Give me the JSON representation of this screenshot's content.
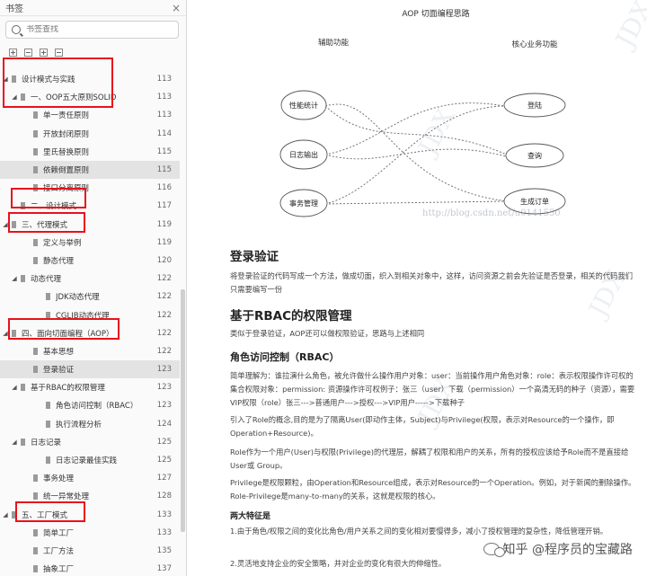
{
  "sidebar": {
    "title": "书签",
    "close_glyph": "×",
    "search": {
      "placeholder": "书签查找",
      "icon": "search-icon"
    },
    "items": [
      {
        "label": "设计模式与实践",
        "page": "113",
        "level": 0,
        "arrow": "◢"
      },
      {
        "label": "一、OOP五大原则SOLID",
        "page": "113",
        "level": 1,
        "arrow": "◢"
      },
      {
        "label": "单一责任原则",
        "page": "113",
        "level": 2,
        "arrow": ""
      },
      {
        "label": "开放封闭原则",
        "page": "114",
        "level": 2,
        "arrow": ""
      },
      {
        "label": "里氏替换原则",
        "page": "115",
        "level": 2,
        "arrow": ""
      },
      {
        "label": "依赖倒置原则",
        "page": "115",
        "level": 2,
        "arrow": "",
        "selected": true
      },
      {
        "label": "接口分离原则",
        "page": "116",
        "level": 2,
        "arrow": ""
      },
      {
        "label": "二、设计模式",
        "page": "117",
        "level": 1,
        "arrow": ""
      },
      {
        "label": "三、代理模式",
        "page": "119",
        "level": 0,
        "arrow": "◢"
      },
      {
        "label": "定义与举例",
        "page": "119",
        "level": 2,
        "arrow": ""
      },
      {
        "label": "静态代理",
        "page": "120",
        "level": 2,
        "arrow": ""
      },
      {
        "label": "动态代理",
        "page": "122",
        "level": 1,
        "arrow": "◢"
      },
      {
        "label": "JDK动态代理",
        "page": "122",
        "level": 3,
        "arrow": ""
      },
      {
        "label": "CGLIB动态代理",
        "page": "122",
        "level": 3,
        "arrow": ""
      },
      {
        "label": "四、面向切面编程（AOP）",
        "page": "122",
        "level": 0,
        "arrow": "◢"
      },
      {
        "label": "基本思想",
        "page": "122",
        "level": 2,
        "arrow": ""
      },
      {
        "label": "登录验证",
        "page": "123",
        "level": 2,
        "arrow": "",
        "selected": true
      },
      {
        "label": "基于RBAC的权限管理",
        "page": "123",
        "level": 1,
        "arrow": "◢"
      },
      {
        "label": "角色访问控制（RBAC）",
        "page": "123",
        "level": 3,
        "arrow": ""
      },
      {
        "label": "执行流程分析",
        "page": "124",
        "level": 3,
        "arrow": ""
      },
      {
        "label": "日志记录",
        "page": "125",
        "level": 1,
        "arrow": "◢"
      },
      {
        "label": "日志记录最佳实践",
        "page": "125",
        "level": 3,
        "arrow": ""
      },
      {
        "label": "事务处理",
        "page": "127",
        "level": 2,
        "arrow": ""
      },
      {
        "label": "统一异常处理",
        "page": "128",
        "level": 2,
        "arrow": ""
      },
      {
        "label": "五、工厂模式",
        "page": "133",
        "level": 0,
        "arrow": "◢"
      },
      {
        "label": "简单工厂",
        "page": "133",
        "level": 2,
        "arrow": ""
      },
      {
        "label": "工厂方法",
        "page": "135",
        "level": 2,
        "arrow": ""
      },
      {
        "label": "抽象工厂",
        "page": "137",
        "level": 2,
        "arrow": ""
      }
    ]
  },
  "diagram": {
    "title": "AOP 切面编程思路",
    "left_header": "辅助功能",
    "right_header": "核心业务功能",
    "left_nodes": [
      "性能统计",
      "日志输出",
      "事务管理"
    ],
    "right_nodes": [
      "登陆",
      "查询",
      "生成订单"
    ],
    "watermark_text": "JDX",
    "url_watermark": "http://blog.csdn.net/u0141550"
  },
  "article": {
    "h_login": "登录验证",
    "p_login": "将登录验证的代码写成一个方法，做成切面，织入到相关对象中，这样，访问资源之前会先验证是否登录，相关的代码我们只需要编写一份",
    "h_rbac": "基于RBAC的权限管理",
    "p_rbac": "类似于登录验证，AOP还可以做权限验证，思路与上述相同",
    "h_rbac_sub": "角色访问控制（RBAC）",
    "p1": "简单理解为：谁拉演什么角色，被允许做什么操作用户对象：user：当前操作用户角色对象：role：表示权限操作许可权的集合权限对象：permission: 资源操作许可权例子：张三（user）下载（permission）一个高清无码的种子（资源），需要VIP权限（role）张三--->普通用户--->授权--->VIP用户----->下载种子",
    "p2": "引入了Role的概念,目的是为了隔离User(即动作主体，Subject)与Privilege(权限，表示对Resource的一个操作，即Operation+Resource)。",
    "p3": "Role作为一个用户(User)与权限(Privilege)的代理层，解耦了权限和用户的关系，所有的授权应该给予Role而不是直接给User或 Group。",
    "p4": "Privilege是权限颗粒，由Operation和Resource组成，表示对Resource的一个Operation。例如，对于新闻的删除操作。Role-Privilege是many-to-many的关系，这就是权限的核心。",
    "h_two": "两大特征是",
    "p5": "1.由于角色/权限之间的变化比角色/用户关系之间的变化相对要慢得多，减小了授权管理的复杂性，降低管理开销。",
    "p6": "2.灵活地支持企业的安全策略，并对企业的变化有很大的伸缩性。",
    "wechat": "知乎 @程序员的宝藏路"
  },
  "colors": {
    "highlight": "#e8121a",
    "sidebar_bg": "#fafafa",
    "selected_row": "#e3e3e3"
  }
}
